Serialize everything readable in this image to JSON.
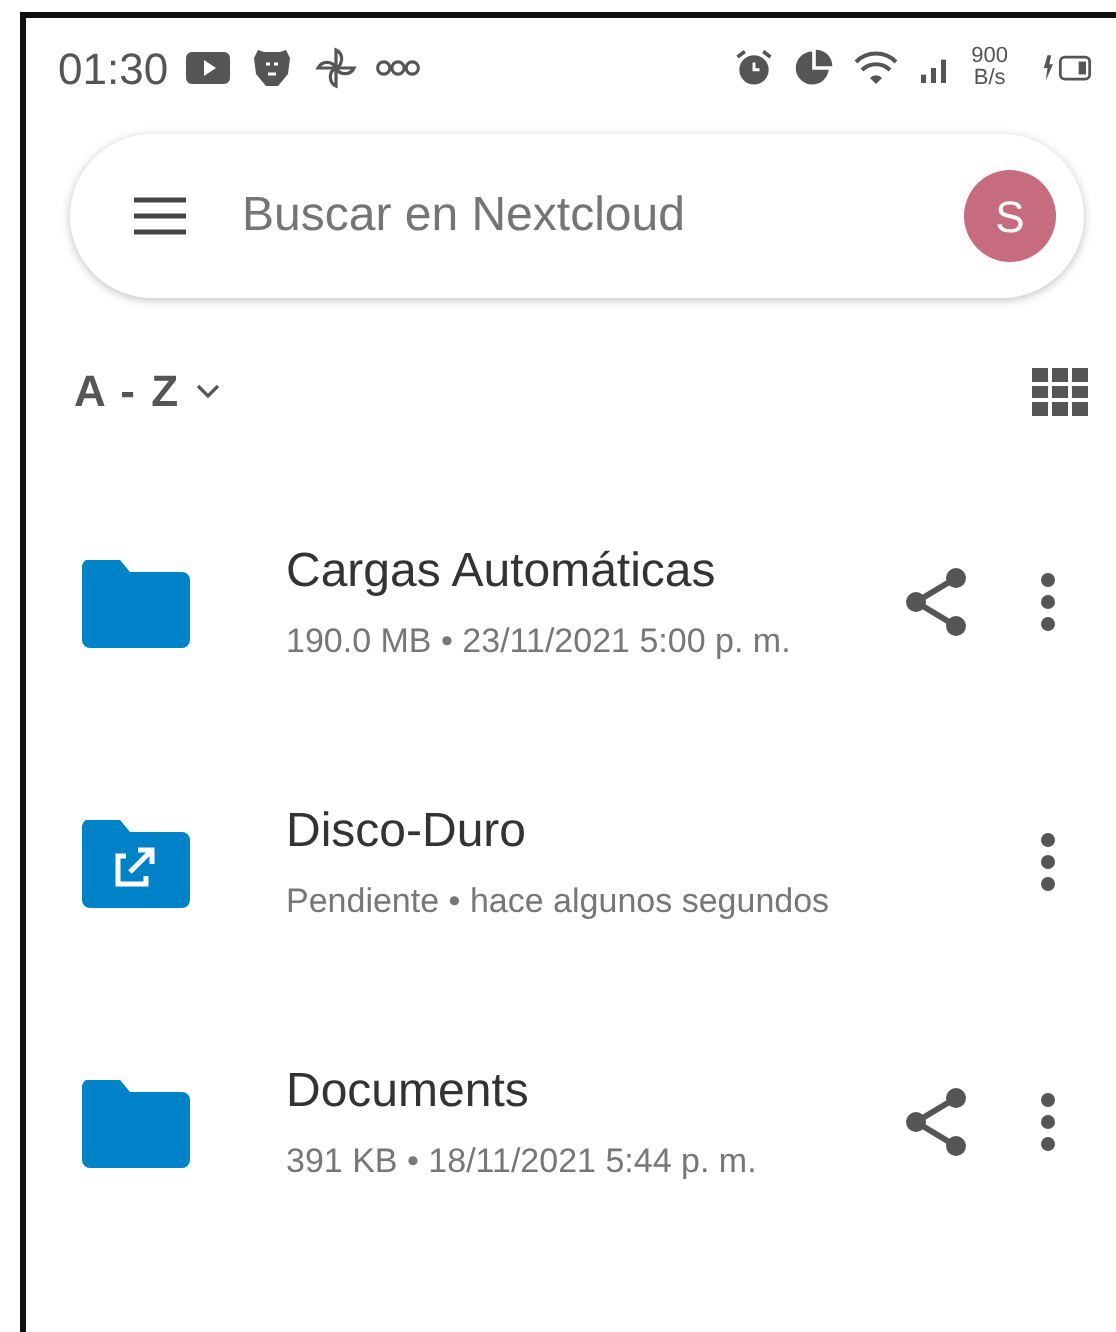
{
  "status_bar": {
    "time": "01:30",
    "speed_value": "900",
    "speed_unit": "B/s"
  },
  "search": {
    "placeholder": "Buscar en Nextcloud",
    "avatar_letter": "S"
  },
  "sort": {
    "label": "A - Z"
  },
  "files": [
    {
      "name": "Cargas Automáticas",
      "details": "190.0 MB • 23/11/2021 5:00 p. m.",
      "kind": "folder",
      "shared": true
    },
    {
      "name": "Disco-Duro",
      "details": "Pendiente • hace algunos segundos",
      "kind": "external",
      "shared": false
    },
    {
      "name": "Documents",
      "details": "391 KB • 18/11/2021 5:44 p. m.",
      "kind": "folder",
      "shared": true
    }
  ]
}
